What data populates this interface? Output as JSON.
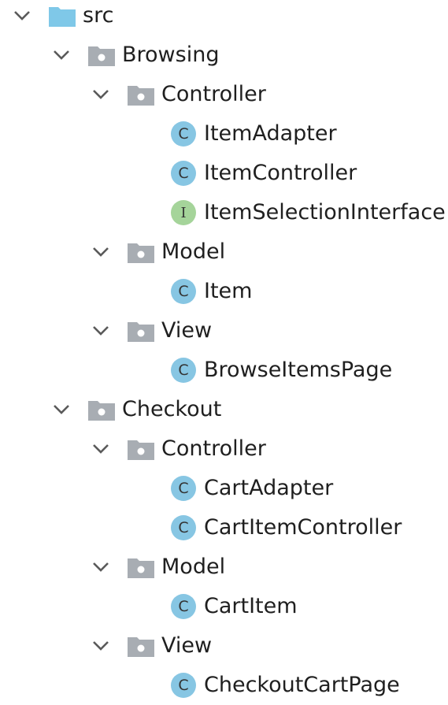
{
  "tree": {
    "src": "src",
    "browsing": {
      "name": "Browsing",
      "controller": {
        "name": "Controller",
        "items": [
          "ItemAdapter",
          "ItemController",
          "ItemSelectionInterface"
        ]
      },
      "model": {
        "name": "Model",
        "items": [
          "Item"
        ]
      },
      "view": {
        "name": "View",
        "items": [
          "BrowseItemsPage"
        ]
      }
    },
    "checkout": {
      "name": "Checkout",
      "controller": {
        "name": "Controller",
        "items": [
          "CartAdapter",
          "CartItemController"
        ]
      },
      "model": {
        "name": "Model",
        "items": [
          "CartItem"
        ]
      },
      "view": {
        "name": "View",
        "items": [
          "CheckoutCartPage"
        ]
      }
    }
  },
  "icons": {
    "chevron": "chevron-down-icon",
    "src_folder": "source-folder-icon",
    "package_folder": "package-folder-icon",
    "class": "class-icon",
    "interface": "interface-icon"
  },
  "colors": {
    "src_folder": "#7fc8e8",
    "package_folder": "#a8adb3",
    "class_badge": "#87c6e3",
    "interface_badge": "#a5d49a",
    "chevron": "#5a5a5a"
  }
}
